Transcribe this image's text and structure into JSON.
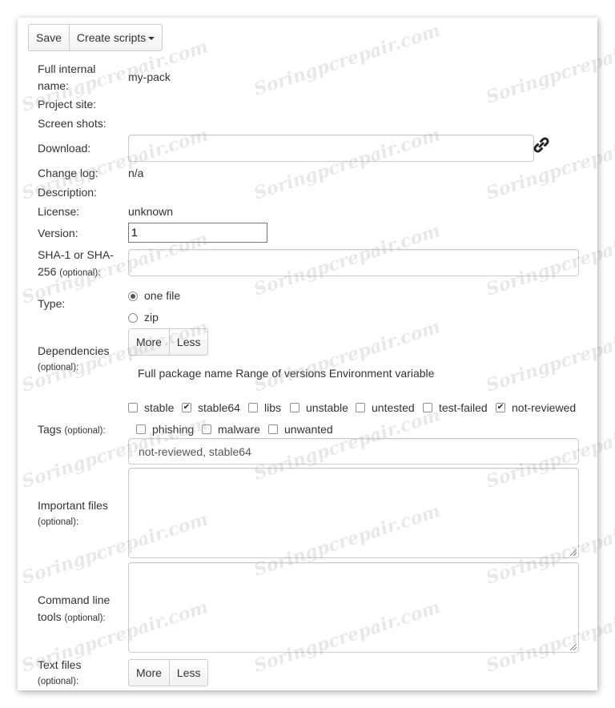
{
  "toolbar": {
    "save_label": "Save",
    "create_scripts_label": "Create scripts"
  },
  "form": {
    "full_internal_name": {
      "label_line1": "Full internal",
      "label_line2": "name:",
      "value": "my-pack"
    },
    "project_site": {
      "label": "Project site:"
    },
    "screen_shots": {
      "label": "Screen shots:"
    },
    "download": {
      "label": "Download:",
      "value": ""
    },
    "change_log": {
      "label": "Change log:",
      "value": "n/a"
    },
    "description": {
      "label": "Description:"
    },
    "license": {
      "label": "License:",
      "value": "unknown"
    },
    "version": {
      "label": "Version:",
      "value": "1"
    },
    "checksum": {
      "label_line1": "SHA-1 or SHA-",
      "label_line2": "256",
      "optional": "(optional):",
      "value": ""
    },
    "type": {
      "label": "Type:",
      "options": [
        {
          "label": "one file",
          "selected": true
        },
        {
          "label": "zip",
          "selected": false
        }
      ]
    },
    "dependencies": {
      "label": "Dependencies",
      "optional": "(optional):",
      "more_label": "More",
      "less_label": "Less",
      "columns": [
        "Full package name",
        "Range of versions",
        "Environment variable"
      ]
    },
    "tags": {
      "label": "Tags",
      "optional": "(optional):",
      "items": [
        {
          "label": "stable",
          "checked": false
        },
        {
          "label": "stable64",
          "checked": true
        },
        {
          "label": "libs",
          "checked": false
        },
        {
          "label": "unstable",
          "checked": false
        },
        {
          "label": "untested",
          "checked": false
        },
        {
          "label": "test-failed",
          "checked": false
        },
        {
          "label": "not-reviewed",
          "checked": true
        },
        {
          "label": "phishing",
          "checked": false
        },
        {
          "label": "malware",
          "checked": false
        },
        {
          "label": "unwanted",
          "checked": false
        }
      ],
      "value": "not-reviewed, stable64"
    },
    "important_files": {
      "label": "Important files",
      "optional": "(optional):",
      "value": ""
    },
    "command_line_tools": {
      "label_line1": "Command line",
      "label_line2": "tools",
      "optional": "(optional):",
      "value": ""
    },
    "text_files": {
      "label": "Text files",
      "optional": "(optional):",
      "more_label": "More",
      "less_label": "Less"
    }
  },
  "watermark": "Soringpcrepair.com",
  "icons": {
    "link": "link-icon",
    "dropdown": "caret-down-icon",
    "check": "check-icon"
  }
}
